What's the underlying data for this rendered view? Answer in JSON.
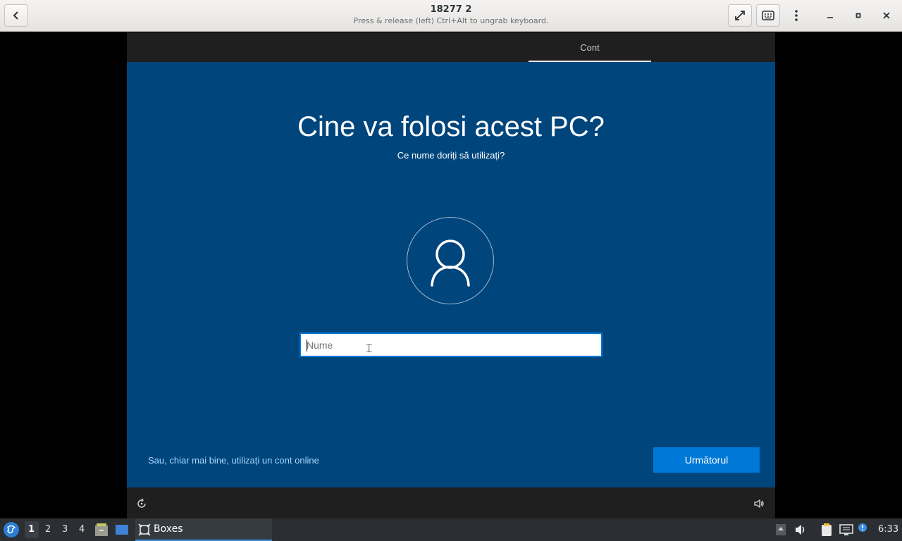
{
  "window": {
    "title": "18277 2",
    "subtitle": "Press & release (left) Ctrl+Alt to ungrab keyboard.",
    "buttons": {
      "back": "back-icon",
      "fullscreen": "fullscreen-icon",
      "keyboard": "keyboard-icon",
      "menu": "kebab-menu-icon",
      "minimize": "minimize-icon",
      "maximize": "maximize-icon",
      "close": "close-icon"
    }
  },
  "vm": {
    "top_tab": "Cont",
    "heading": "Cine va folosi acest PC?",
    "subheading": "Ce nume doriți să utilizați?",
    "name_field": {
      "placeholder": "Nume",
      "value": ""
    },
    "online_link": "Sau, chiar mai bine, utilizați un cont online",
    "next_button": "Următorul",
    "accent_color": "#0078d7",
    "background_color": "#00457c"
  },
  "taskbar": {
    "workspaces": [
      "1",
      "2",
      "3",
      "4"
    ],
    "active_workspace": "1",
    "task_label": "Boxes",
    "clock": "6:33"
  }
}
